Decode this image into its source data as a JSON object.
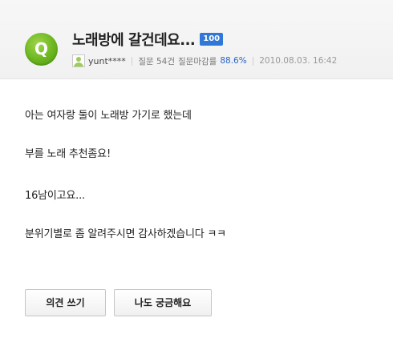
{
  "question": {
    "badge_letter": "Q",
    "title": "노래방에 갈건데요...",
    "points": "100"
  },
  "meta": {
    "username": "yunt****",
    "question_count_label": "질문 54건",
    "closing_rate_label": "질문마감률",
    "closing_rate_value": "88.6%",
    "date": "2010.08.03. 16:42"
  },
  "body": {
    "lines": [
      "아는 여자랑 둘이 노래방 가기로 했는데",
      "부를 노래 추천좀요!",
      "16남이고요...",
      "분위기별로 좀 알려주시면 감사하겠습니다 ㅋㅋ"
    ]
  },
  "actions": {
    "answer_label": "의견 쓰기",
    "curious_label": "나도 궁금해요"
  },
  "colors": {
    "q_badge_green": "#6bb51f",
    "points_badge_blue": "#2f78d8",
    "rate_blue": "#2a63c7"
  }
}
